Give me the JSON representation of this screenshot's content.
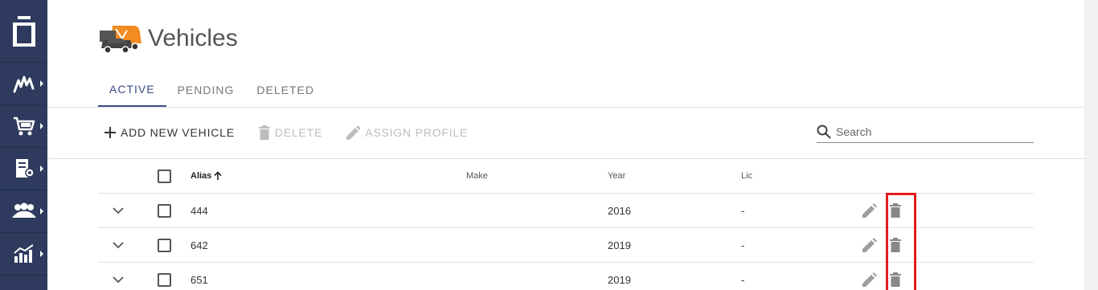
{
  "header": {
    "title": "Vehicles",
    "icon": "vehicles-icon"
  },
  "sidebar": {
    "logo_icon": "app-logo-icon",
    "items": [
      {
        "icon": "routes-icon"
      },
      {
        "icon": "cart-icon"
      },
      {
        "icon": "address-book-icon"
      },
      {
        "icon": "team-icon"
      },
      {
        "icon": "analytics-icon"
      }
    ]
  },
  "tabs": [
    {
      "label": "ACTIVE",
      "active": true
    },
    {
      "label": "PENDING",
      "active": false
    },
    {
      "label": "DELETED",
      "active": false
    }
  ],
  "toolbar": {
    "add_label": "ADD NEW VEHICLE",
    "delete_label": "DELETE",
    "assign_label": "ASSIGN PROFILE"
  },
  "search": {
    "placeholder": "Search",
    "value": ""
  },
  "table": {
    "columns": {
      "alias": "Alias",
      "make": "Make",
      "year": "Year",
      "lic": "Lic"
    },
    "rows": [
      {
        "alias": "444",
        "make": "",
        "year": "2016",
        "lic": "-"
      },
      {
        "alias": "642",
        "make": "",
        "year": "2019",
        "lic": "-"
      },
      {
        "alias": "651",
        "make": "",
        "year": "2019",
        "lic": "-"
      }
    ]
  },
  "colors": {
    "sidebar": "#2e3b5e",
    "accent": "#3b4a86",
    "highlight": "#e21b1b",
    "vehicle_orange": "#f28b20"
  }
}
